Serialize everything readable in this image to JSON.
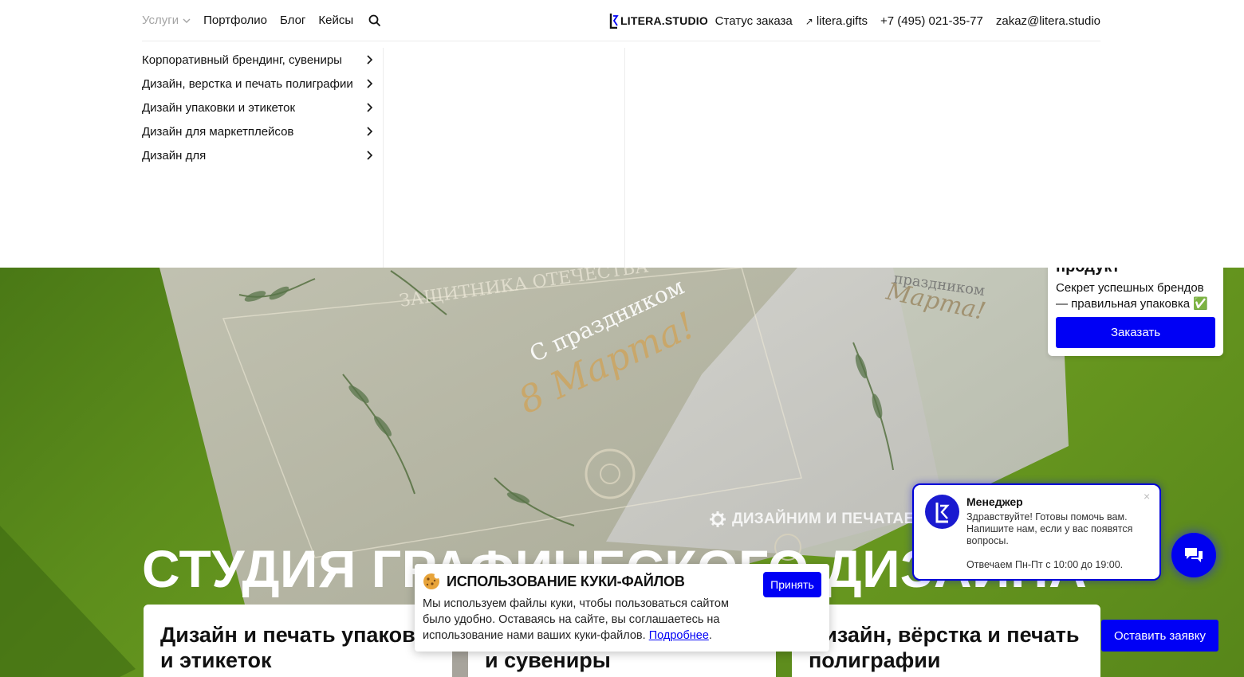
{
  "header": {
    "nav_left": [
      {
        "label": "Услуги"
      },
      {
        "label": "Портфолио"
      },
      {
        "label": "Блог"
      },
      {
        "label": "Кейсы"
      }
    ],
    "logo_text": "LITERA.STUDIO",
    "nav_right": {
      "order_status": "Статус заказа",
      "gifts_link": "litera.gifts",
      "phone": "+7 (495) 021-35-77",
      "email": "zakaz@litera.studio"
    }
  },
  "services_menu": [
    "Корпоративный брендинг, сувениры",
    "Дизайн, верстка и печать полиграфии",
    "Дизайн упаковки и этикеток",
    "Дизайн для маркетплейсов",
    "Дизайн для"
  ],
  "promo": {
    "title": "продукт",
    "text": "Секрет успешных брендов — правильная упаковка ✅",
    "button": "Заказать"
  },
  "hero": {
    "kicker": "ДИЗАЙНИМ И ПЕЧАТАЕМ Н",
    "title": "СТУДИЯ ГРАФИЧЕСКОГО ДИЗАЙНА",
    "card_texts": {
      "emblem": "ЗАЩИТНИКА ОТЕЧЕСТВА",
      "greeting": "С праздником",
      "march": "8 Марта!",
      "greeting_2": "праздником",
      "march_2": "Марта!"
    }
  },
  "cards": [
    "Дизайн и печать упаковки и этикеток",
    "Корпоративный брендинг и сувениры",
    "Дизайн, вёрстка и печать полиграфии"
  ],
  "cookie": {
    "title": "ИСПОЛЬЗОВАНИЕ КУКИ-ФАЙЛОВ",
    "text": "Мы используем файлы куки, чтобы пользоваться сайтом было удобно. Оставаясь на сайте, вы соглашаетесь на использование нами ваших куки-файлов.",
    "link": "Подробнее",
    "accept": "Принять"
  },
  "chat": {
    "name": "Менеджер",
    "message": "Здравствуйте! Готовы помочь вам. Напишите нам, если у вас появятся вопросы.",
    "hours": "Отвечаем Пн-Пт с 10:00 до 19:00.",
    "close": "×"
  },
  "request_button": "Оставить заявку",
  "colors": {
    "accent": "#0000f5",
    "hero_green": "#5d8e1c",
    "menu_inactive": "#a4a4a4"
  }
}
